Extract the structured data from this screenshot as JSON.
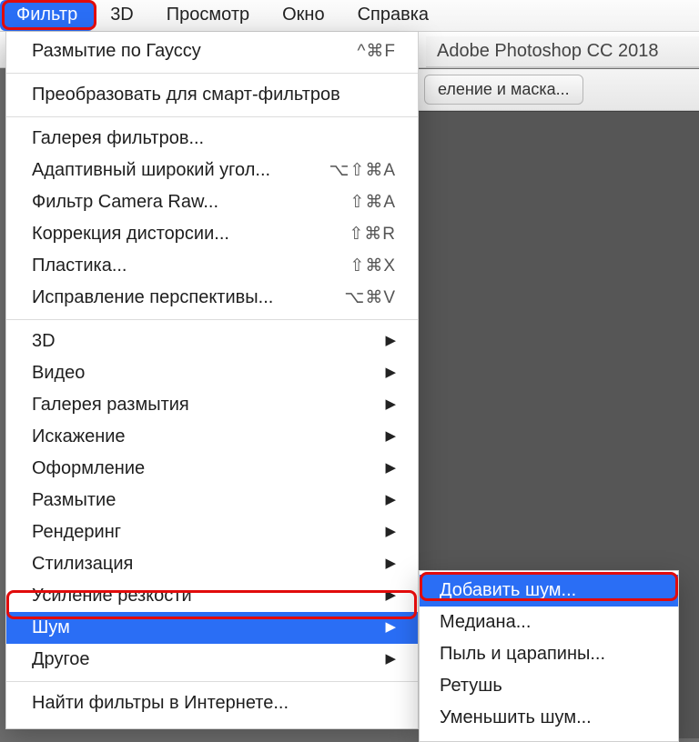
{
  "menubar": {
    "items": [
      "Фильтр",
      "3D",
      "Просмотр",
      "Окно",
      "Справка"
    ],
    "active_index": 0
  },
  "app_title": "Adobe Photoshop CC 2018",
  "options_bar": {
    "button": "еление и маска..."
  },
  "dropdown": {
    "section1": [
      {
        "label": "Размытие по Гауссу",
        "shortcut": "^⌘F"
      }
    ],
    "section2": [
      {
        "label": "Преобразовать для смарт-фильтров"
      }
    ],
    "section3": [
      {
        "label": "Галерея фильтров..."
      },
      {
        "label": "Адаптивный широкий угол...",
        "shortcut": "⌥⇧⌘A"
      },
      {
        "label": "Фильтр Camera Raw...",
        "shortcut": "⇧⌘A"
      },
      {
        "label": "Коррекция дисторсии...",
        "shortcut": "⇧⌘R"
      },
      {
        "label": "Пластика...",
        "shortcut": "⇧⌘X"
      },
      {
        "label": "Исправление перспективы...",
        "shortcut": "⌥⌘V"
      }
    ],
    "section4": [
      {
        "label": "3D",
        "arrow": true
      },
      {
        "label": "Видео",
        "arrow": true
      },
      {
        "label": "Галерея размытия",
        "arrow": true
      },
      {
        "label": "Искажение",
        "arrow": true
      },
      {
        "label": "Оформление",
        "arrow": true
      },
      {
        "label": "Размытие",
        "arrow": true
      },
      {
        "label": "Рендеринг",
        "arrow": true
      },
      {
        "label": "Стилизация",
        "arrow": true
      },
      {
        "label": "Усиление резкости",
        "arrow": true
      },
      {
        "label": "Шум",
        "arrow": true,
        "selected": true
      },
      {
        "label": "Другое",
        "arrow": true
      }
    ],
    "section5": [
      {
        "label": "Найти фильтры в Интернете..."
      }
    ]
  },
  "submenu": {
    "items": [
      {
        "label": "Добавить шум...",
        "selected": true
      },
      {
        "label": "Медиана..."
      },
      {
        "label": "Пыль и царапины..."
      },
      {
        "label": "Ретушь"
      },
      {
        "label": "Уменьшить шум..."
      }
    ]
  }
}
